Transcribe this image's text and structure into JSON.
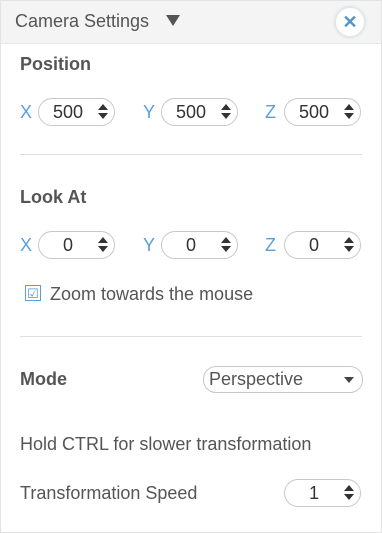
{
  "header": {
    "title": "Camera Settings",
    "close_icon": "close-icon",
    "collapse_icon": "caret-down-icon"
  },
  "position": {
    "title": "Position",
    "x_label": "X",
    "x_value": "500",
    "y_label": "Y",
    "y_value": "500",
    "z_label": "Z",
    "z_value": "500"
  },
  "look_at": {
    "title": "Look At",
    "x_label": "X",
    "x_value": "0",
    "y_label": "Y",
    "y_value": "0",
    "z_label": "Z",
    "z_value": "0"
  },
  "zoom": {
    "checked": true,
    "check_glyph": "☑",
    "label": "Zoom towards the mouse"
  },
  "mode": {
    "title": "Mode",
    "selected": "Perspective"
  },
  "hint": {
    "text": "Hold CTRL for slower transformation"
  },
  "speed": {
    "label": "Transformation Speed",
    "value": "1"
  },
  "colors": {
    "accent": "#4e95cf",
    "axis_label": "#5aa0d8",
    "header_bg": "#f4f4f4",
    "text": "#555555"
  }
}
